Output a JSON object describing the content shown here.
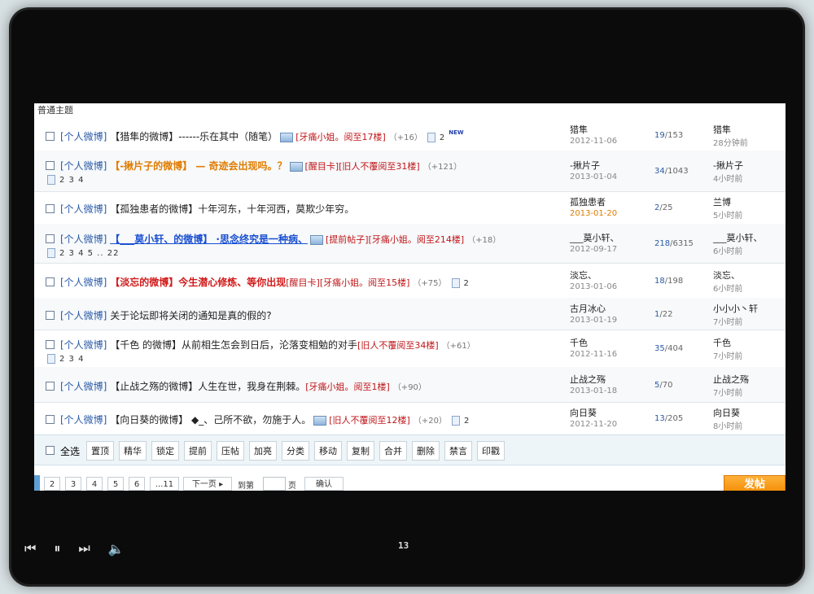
{
  "section_label": "普通主题",
  "rows": [
    {
      "category": "[个人微博]",
      "title_html": "【猎隼的微博】------乐在其中（随笔）",
      "style": "normal",
      "tags": [
        "[牙痛小姐。阅至17楼]"
      ],
      "has_image": true,
      "reply_count": "（+16）",
      "pages_inline": "2",
      "new_badge": "NEW",
      "pages_line2": "",
      "author": "猎隼",
      "date": "2012-11-06",
      "date_hot": false,
      "stats_replies": "19",
      "stats_views": "/153",
      "last_poster": "猎隼",
      "last_time": "28分钟前"
    },
    {
      "category": "[个人微博]",
      "title_html": "【-揪片子的微博】  — 奇迹会出现吗。？",
      "style": "orange",
      "tags": [
        "[醒目卡]",
        "[旧人不覆阅至31楼]"
      ],
      "has_image": true,
      "reply_count": "（+121）",
      "pages_inline": "",
      "new_badge": "",
      "pages_line2": "2 3 4",
      "author": "-揪片子",
      "date": "2013-01-04",
      "date_hot": false,
      "stats_replies": "34",
      "stats_views": "/1043",
      "last_poster": "-揪片子",
      "last_time": "4小时前"
    },
    {
      "category": "[个人微博]",
      "title_html": "【孤独患者的微博】十年河东，十年河西，莫欺少年穷。",
      "style": "normal",
      "tags": [],
      "has_image": false,
      "reply_count": "",
      "pages_inline": "",
      "new_badge": "",
      "pages_line2": "",
      "author": "孤独患者",
      "date": "2013-01-20",
      "date_hot": true,
      "stats_replies": "2",
      "stats_views": "/25",
      "last_poster": "兰博",
      "last_time": "5小时前"
    },
    {
      "category": "[个人微博]",
      "title_html": "【___莫小轩、的微博】 ·思念终究是一种病、",
      "style": "blue",
      "tags": [
        "[提前帖子]",
        "[牙痛小姐。阅至214楼]"
      ],
      "has_image": true,
      "reply_count": "（+18）",
      "pages_inline": "",
      "new_badge": "",
      "pages_line2": "2 3 4 5 .. 22",
      "author": "___莫小轩、",
      "date": "2012-09-17",
      "date_hot": false,
      "stats_replies": "218",
      "stats_views": "/6315",
      "last_poster": "___莫小轩、",
      "last_time": "6小时前"
    },
    {
      "category": "[个人微博]",
      "title_html": "【淡忘的微博】今生潜心修炼、等你出现",
      "style": "red",
      "tags": [
        "[醒目卡]",
        "[牙痛小姐。阅至15楼]"
      ],
      "has_image": false,
      "reply_count": "（+75）",
      "pages_inline": "2",
      "new_badge": "",
      "pages_line2": "",
      "author": "淡忘、",
      "date": "2013-01-06",
      "date_hot": false,
      "stats_replies": "18",
      "stats_views": "/198",
      "last_poster": "淡忘、",
      "last_time": "6小时前"
    },
    {
      "category": "[个人微博]",
      "title_html": "关于论坛即将关闭的通知是真的假的?",
      "style": "normal",
      "tags": [],
      "has_image": false,
      "reply_count": "",
      "pages_inline": "",
      "new_badge": "",
      "pages_line2": "",
      "author": "古月冰心",
      "date": "2013-01-19",
      "date_hot": false,
      "stats_replies": "1",
      "stats_views": "/22",
      "last_poster": "小小小丶轩",
      "last_time": "7小时前"
    },
    {
      "category": "[个人微博]",
      "title_html": "【千色 的微博】从前相生怎会到日后，沦落变相勉的对手",
      "style": "normal",
      "tags": [
        "[旧人不覆阅至34楼]"
      ],
      "has_image": false,
      "reply_count": "（+61）",
      "pages_inline": "",
      "new_badge": "",
      "pages_line2": "2 3 4",
      "author": "千色",
      "date": "2012-11-16",
      "date_hot": false,
      "stats_replies": "35",
      "stats_views": "/404",
      "last_poster": "千色",
      "last_time": "7小时前"
    },
    {
      "category": "[个人微博]",
      "title_html": "【止战之殇的微博】人生在世，我身在荆棘。",
      "style": "normal",
      "tags": [
        "[牙痛小姐。阅至1楼]"
      ],
      "has_image": false,
      "reply_count": "（+90）",
      "pages_inline": "",
      "new_badge": "",
      "pages_line2": "",
      "author": "止战之殇",
      "date": "2013-01-18",
      "date_hot": false,
      "stats_replies": "5",
      "stats_views": "/70",
      "last_poster": "止战之殇",
      "last_time": "7小时前"
    },
    {
      "category": "[个人微博]",
      "title_html": "【向日葵的微博】 ◆_、己所不欲，勿施于人。",
      "style": "normal",
      "tags": [
        "[旧人不覆阅至12楼]"
      ],
      "has_image": true,
      "reply_count": "（+20）",
      "pages_inline": "2",
      "new_badge": "",
      "pages_line2": "",
      "author": "向日葵",
      "date": "2012-11-20",
      "date_hot": false,
      "stats_replies": "13",
      "stats_views": "/205",
      "last_poster": "向日葵",
      "last_time": "8小时前"
    }
  ],
  "mod_bar": {
    "select_all": "全选",
    "buttons": [
      "置顶",
      "精华",
      "锁定",
      "提前",
      "压帖",
      "加亮",
      "分类",
      "移动",
      "复制",
      "合并",
      "删除",
      "禁言",
      "印戳"
    ]
  },
  "pager": {
    "pages": [
      "2",
      "3",
      "4",
      "5",
      "6",
      "...11"
    ],
    "next": "下一页",
    "goto_label": "到第",
    "page_unit": "页",
    "confirm": "确认",
    "post": "发帖"
  },
  "player": {
    "page_number": "13"
  }
}
